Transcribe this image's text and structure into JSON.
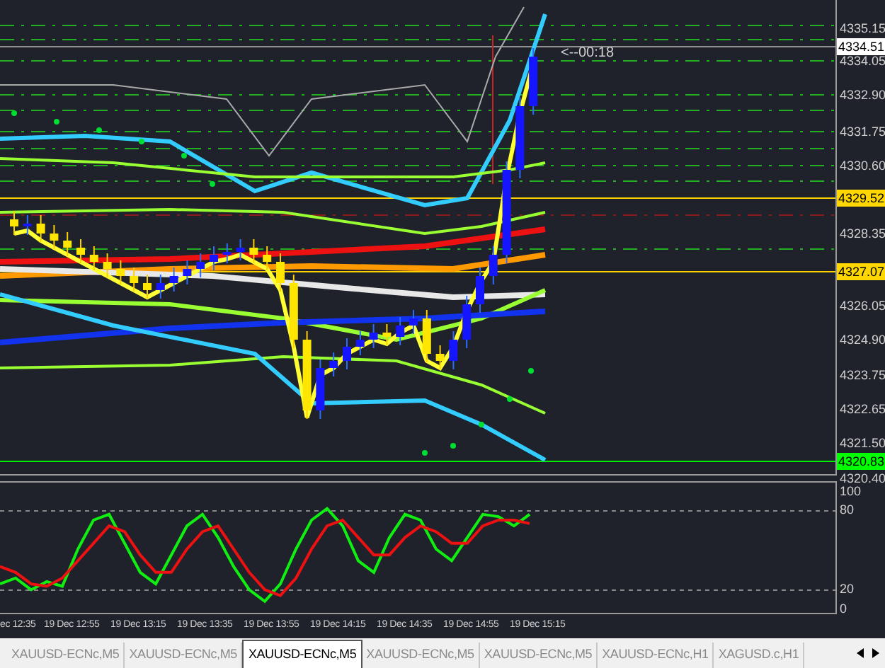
{
  "price_axis": [
    {
      "kind": "tick",
      "text": "4335.15"
    },
    {
      "kind": "marker",
      "text": "4334.51",
      "color": "#ffffff"
    },
    {
      "kind": "tick",
      "text": "4334.05"
    },
    {
      "kind": "tick",
      "text": "4332.90"
    },
    {
      "kind": "tick",
      "text": "4331.75"
    },
    {
      "kind": "tick",
      "text": "4330.60"
    },
    {
      "kind": "marker",
      "text": "4329.52",
      "color": "#ffd700"
    },
    {
      "kind": "tick",
      "text": "4328.35"
    },
    {
      "kind": "marker",
      "text": "4327.07",
      "color": "#ffd700"
    },
    {
      "kind": "tick",
      "text": "4326.05"
    },
    {
      "kind": "tick",
      "text": "4324.90"
    },
    {
      "kind": "tick",
      "text": "4323.75"
    },
    {
      "kind": "tick",
      "text": "4322.65"
    },
    {
      "kind": "tick",
      "text": "4321.50"
    },
    {
      "kind": "marker",
      "text": "4320.83",
      "color": "#00ff00"
    },
    {
      "kind": "tick",
      "text": "4320.40"
    }
  ],
  "timer": "<--00:18",
  "oscillator_axis": [
    "100",
    "80",
    "20",
    "0"
  ],
  "time_axis": [
    "ec 12:35",
    "19 Dec 12:55",
    "19 Dec 13:15",
    "19 Dec 13:35",
    "19 Dec 13:55",
    "19 Dec 14:15",
    "19 Dec 14:35",
    "19 Dec 14:55",
    "19 Dec 15:15"
  ],
  "tabs": [
    {
      "label": "XAUUSD-ECNc,M5",
      "selected": false
    },
    {
      "label": "XAUUSD-ECNc,M5",
      "selected": false
    },
    {
      "label": "XAUUSD-ECNc,M5",
      "selected": true
    },
    {
      "label": "XAUUSD-ECNc,M5",
      "selected": false
    },
    {
      "label": "XAUUSD-ECNc,M5",
      "selected": false
    },
    {
      "label": "XAUUSD-ECNc,H1",
      "selected": false
    },
    {
      "label": "XAGUSD.c,H1",
      "selected": false
    }
  ]
}
